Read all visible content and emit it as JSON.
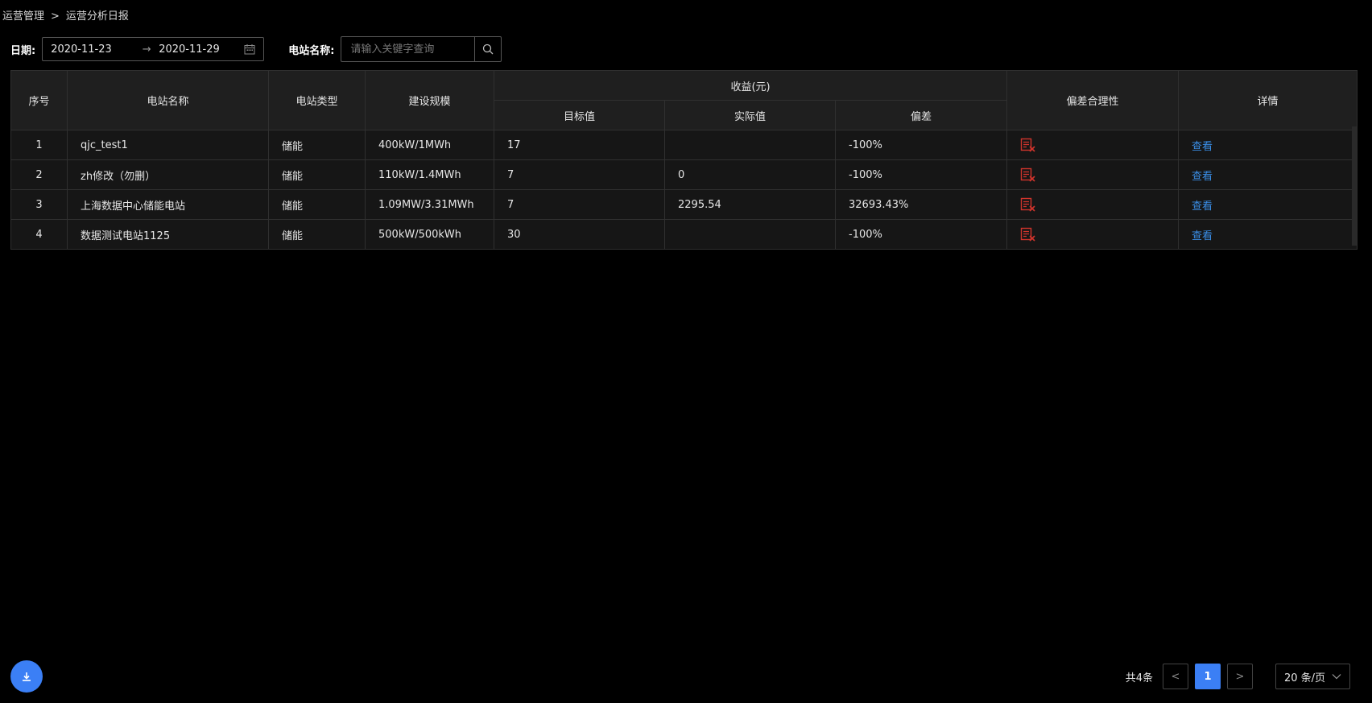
{
  "breadcrumb": {
    "parent": "运营管理",
    "separator": ">",
    "current": "运营分析日报"
  },
  "filters": {
    "date_label": "日期:",
    "start_date": "2020-11-23",
    "range_arrow": "→",
    "end_date": "2020-11-29",
    "station_label": "电站名称:",
    "search_placeholder": "请输入关键字查询"
  },
  "table": {
    "headers": {
      "index": "序号",
      "station_name": "电站名称",
      "station_type": "电站类型",
      "scale": "建设规模",
      "revenue_group": "收益(元)",
      "target": "目标值",
      "actual": "实际值",
      "deviation": "偏差",
      "reasonable": "偏差合理性",
      "detail": "详情"
    },
    "rows": [
      {
        "index": "1",
        "name": "qjc_test1",
        "type": "储能",
        "scale": "400kW/1MWh",
        "target": "17",
        "actual": "",
        "deviation": "-100%",
        "detail": "查看"
      },
      {
        "index": "2",
        "name": "zh修改（勿删）",
        "type": "储能",
        "scale": "110kW/1.4MWh",
        "target": "7",
        "actual": "0",
        "deviation": "-100%",
        "detail": "查看"
      },
      {
        "index": "3",
        "name": "上海数据中心储能电站",
        "type": "储能",
        "scale": "1.09MW/3.31MWh",
        "target": "7",
        "actual": "2295.54",
        "deviation": "32693.43%",
        "detail": "查看"
      },
      {
        "index": "4",
        "name": "数据测试电站1125",
        "type": "储能",
        "scale": "500kW/500kWh",
        "target": "30",
        "actual": "",
        "deviation": "-100%",
        "detail": "查看"
      }
    ]
  },
  "pagination": {
    "total": "共4条",
    "prev": "<",
    "current_page": "1",
    "next": ">",
    "page_size": "20 条/页"
  },
  "colors": {
    "accent": "#3b7ff5",
    "link": "#3a8ee6",
    "fail_icon": "#d0342c"
  }
}
